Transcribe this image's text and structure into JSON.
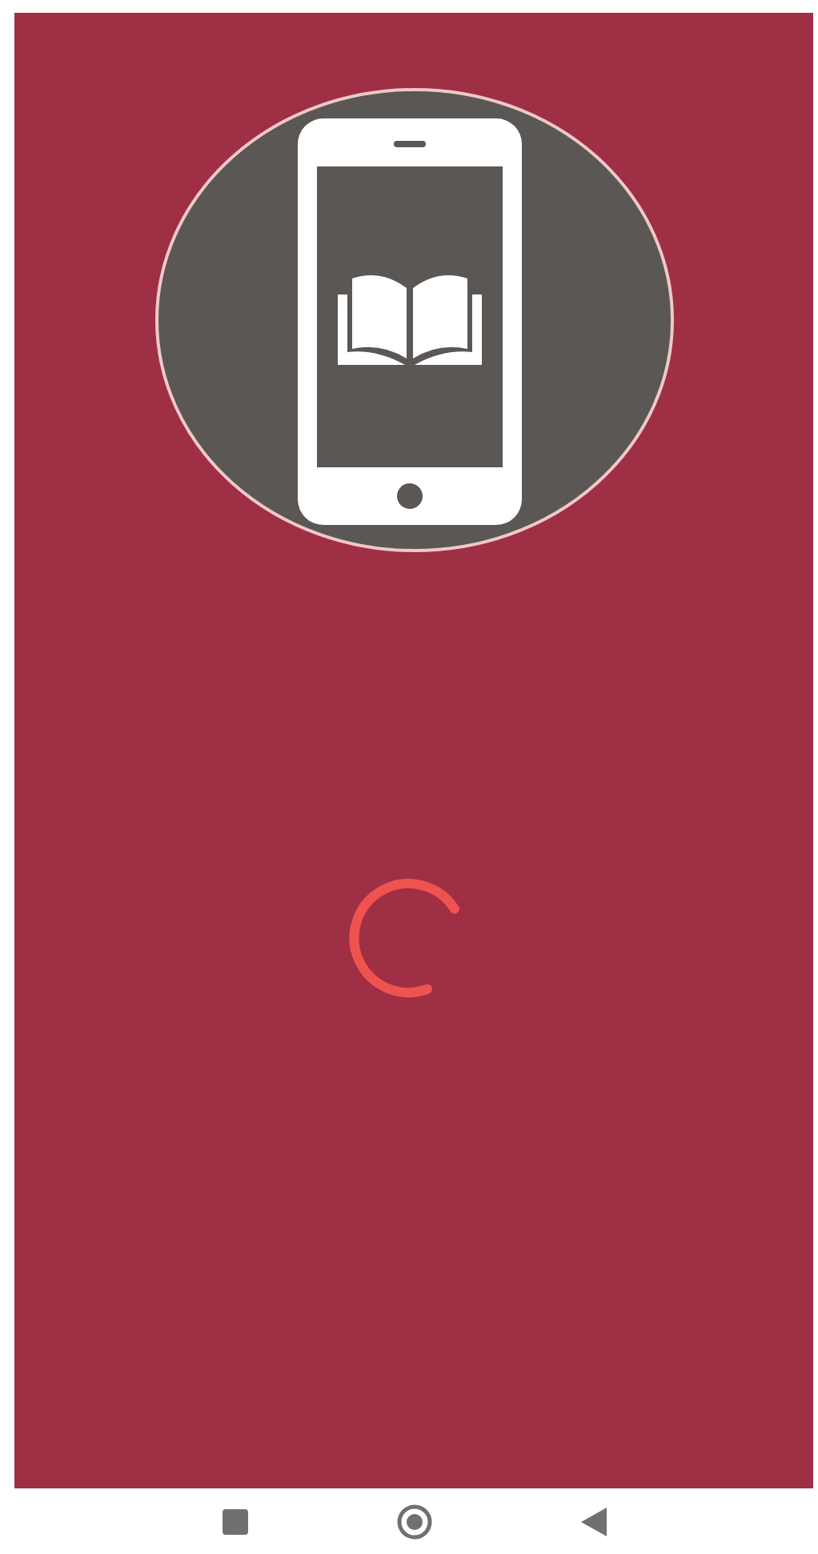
{
  "splash": {
    "kind": "loading"
  },
  "nav_bar": [
    {
      "kind": "recents"
    },
    {
      "kind": "home"
    },
    {
      "kind": "back"
    }
  ]
}
